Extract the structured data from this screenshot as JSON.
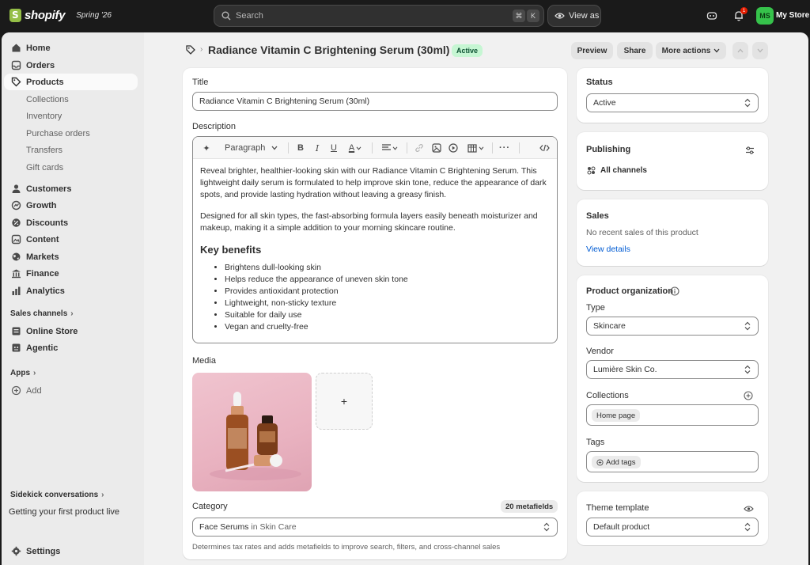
{
  "topbar": {
    "logo_text": "shopify",
    "edition": "Spring '26",
    "search_placeholder": "Search",
    "shortcut_cmd": "⌘",
    "shortcut_key": "K",
    "view_as": "View as",
    "notification_count": "1",
    "store_initials": "MS",
    "store_name": "My Store"
  },
  "sidebar": {
    "items": [
      {
        "label": "Home",
        "icon": "home-icon"
      },
      {
        "label": "Orders",
        "icon": "inbox-icon"
      },
      {
        "label": "Products",
        "icon": "tag-icon"
      },
      {
        "label": "Collections"
      },
      {
        "label": "Inventory"
      },
      {
        "label": "Purchase orders"
      },
      {
        "label": "Transfers"
      },
      {
        "label": "Gift cards"
      },
      {
        "label": "Customers",
        "icon": "person-icon"
      },
      {
        "label": "Growth",
        "icon": "growth-icon"
      },
      {
        "label": "Discounts",
        "icon": "discount-icon"
      },
      {
        "label": "Content",
        "icon": "content-icon"
      },
      {
        "label": "Markets",
        "icon": "globe-icon"
      },
      {
        "label": "Finance",
        "icon": "bank-icon"
      },
      {
        "label": "Analytics",
        "icon": "bar-chart-icon"
      }
    ],
    "sales_channels_label": "Sales channels",
    "channels": [
      {
        "label": "Online Store",
        "icon": "store-icon"
      },
      {
        "label": "Agentic",
        "icon": "agent-icon"
      }
    ],
    "apps_label": "Apps",
    "add_label": "Add",
    "sidekick_label": "Sidekick conversations",
    "sidekick_item": "Getting your first product live",
    "settings_label": "Settings"
  },
  "header": {
    "title": "Radiance Vitamin C Brightening Serum (30ml)",
    "status_badge": "Active",
    "preview": "Preview",
    "share": "Share",
    "more_actions": "More actions"
  },
  "main": {
    "title_label": "Title",
    "title_value": "Radiance Vitamin C Brightening Serum (30ml)",
    "description_label": "Description",
    "paragraph_select": "Paragraph",
    "description": {
      "p1": "Reveal brighter, healthier-looking skin with our Radiance Vitamin C Brightening Serum. This lightweight daily serum is formulated to help improve skin tone, reduce the appearance of dark spots, and provide lasting hydration without leaving a greasy finish.",
      "p2": "Designed for all skin types, the fast-absorbing formula layers easily beneath moisturizer and makeup, making it a simple addition to your morning skincare routine.",
      "heading": "Key benefits",
      "bullets": [
        "Brightens dull-looking skin",
        "Helps reduce the appearance of uneven skin tone",
        "Provides antioxidant protection",
        "Lightweight, non-sticky texture",
        "Suitable for daily use",
        "Vegan and cruelty-free"
      ]
    },
    "media_label": "Media",
    "media_add": "+",
    "category_label": "Category",
    "metafields": "20 metafields",
    "category_value": "Face Serums",
    "category_in": " in ",
    "category_parent": "Skin Care",
    "category_help": "Determines tax rates and adds metafields to improve search, filters, and cross-channel sales"
  },
  "right": {
    "status_label": "Status",
    "status_value": "Active",
    "publishing_label": "Publishing",
    "publishing_value": "All channels",
    "sales_label": "Sales",
    "sales_text": "No recent sales of this product",
    "sales_link": "View details",
    "org_label": "Product organization",
    "type_label": "Type",
    "type_value": "Skincare",
    "vendor_label": "Vendor",
    "vendor_value": "Lumière Skin Co.",
    "collections_label": "Collections",
    "collection_chip": "Home page",
    "tags_label": "Tags",
    "add_tags": "Add tags",
    "theme_label": "Theme template",
    "theme_value": "Default product"
  },
  "colors": {
    "topbar": "#1a1a1a",
    "frame": "#f1f1f1",
    "badge_green": "#c6f6d3",
    "link": "#005bd3",
    "avatar": "#36c24b"
  }
}
